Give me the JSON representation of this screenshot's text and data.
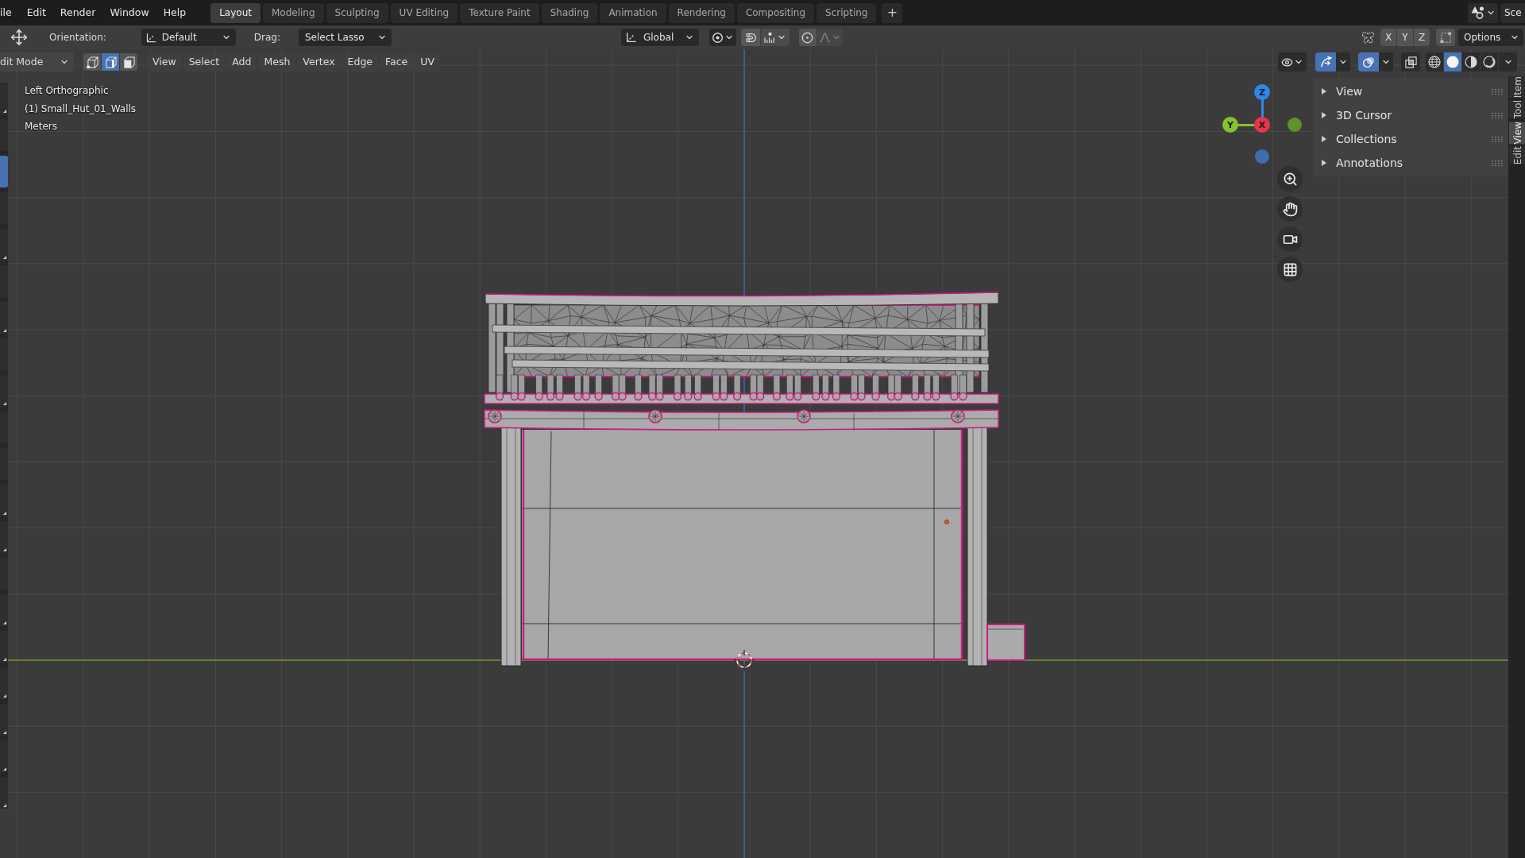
{
  "top_bar": {
    "menus": [
      "ile",
      "Edit",
      "Render",
      "Window",
      "Help"
    ],
    "workspaces": [
      {
        "label": "Layout",
        "selected": true
      },
      {
        "label": "Modeling",
        "selected": false
      },
      {
        "label": "Sculpting",
        "selected": false
      },
      {
        "label": "UV Editing",
        "selected": false
      },
      {
        "label": "Texture Paint",
        "selected": false
      },
      {
        "label": "Shading",
        "selected": false
      },
      {
        "label": "Animation",
        "selected": false
      },
      {
        "label": "Rendering",
        "selected": false
      },
      {
        "label": "Compositing",
        "selected": false
      },
      {
        "label": "Scripting",
        "selected": false
      }
    ],
    "add_workspace": "+",
    "scene": "Sce"
  },
  "tool_settings": {
    "orientation": {
      "label": "Orientation:",
      "value": "Default"
    },
    "drag": {
      "label": "Drag:",
      "value": "Select Lasso"
    },
    "transform_orientation": "Global",
    "proportional_editing": {
      "on": false
    },
    "mirror": [
      {
        "label": "X",
        "on": false
      },
      {
        "label": "Y",
        "on": false
      },
      {
        "label": "Z",
        "on": false
      }
    ],
    "options": "Options"
  },
  "viewport_header": {
    "mode": "dit Mode",
    "select_modes": [
      {
        "kind": "vertex",
        "selected": false
      },
      {
        "kind": "edge",
        "selected": true
      },
      {
        "kind": "face",
        "selected": false
      }
    ],
    "menus": [
      "View",
      "Select",
      "Add",
      "Mesh",
      "Vertex",
      "Edge",
      "Face",
      "UV"
    ],
    "gizmos": {
      "on": true
    },
    "overlays": {
      "on": true
    },
    "xray": {
      "on": false
    },
    "shading": [
      {
        "kind": "wireframe",
        "selected": false
      },
      {
        "kind": "solid",
        "selected": true
      },
      {
        "kind": "material",
        "selected": false
      },
      {
        "kind": "rendered",
        "selected": false
      }
    ]
  },
  "toolbar": {
    "tools": [
      {
        "selected": false,
        "subtools": true
      },
      {
        "selected": false,
        "subtools": false
      },
      {
        "selected": true,
        "subtools": false
      },
      {
        "selected": false,
        "subtools": false
      },
      {
        "selected": false,
        "subtools": true
      },
      {
        "selected": false,
        "subtools": false
      },
      {
        "selected": false,
        "subtools": true
      },
      {
        "selected": false,
        "subtools": false
      },
      {
        "selected": false,
        "subtools": true
      },
      {
        "selected": false,
        "subtools": false
      },
      {
        "selected": false,
        "subtools": false
      },
      {
        "selected": false,
        "subtools": true
      },
      {
        "selected": false,
        "subtools": true
      },
      {
        "selected": false,
        "subtools": false
      },
      {
        "selected": false,
        "subtools": true
      },
      {
        "selected": false,
        "subtools": true
      },
      {
        "selected": false,
        "subtools": true
      },
      {
        "selected": false,
        "subtools": true
      },
      {
        "selected": false,
        "subtools": true
      },
      {
        "selected": false,
        "subtools": true
      }
    ]
  },
  "viewport": {
    "view_name": "Left Orthographic",
    "object_name": "(1) Small_Hut_01_Walls",
    "units": "Meters"
  },
  "gizmo": {
    "axes": [
      {
        "kind": "axis",
        "label": "Z",
        "color": "#2e87ea"
      },
      {
        "kind": "axis",
        "label": "X",
        "color": "#e8354c"
      },
      {
        "kind": "axis",
        "label": "Y",
        "color": "#86c32b"
      },
      {
        "kind": "dot",
        "color": "#5f9130"
      },
      {
        "kind": "dot",
        "color": "#3f6eb0"
      }
    ]
  },
  "sidebar": {
    "panels": [
      {
        "label": "View",
        "expanded": false
      },
      {
        "label": "3D Cursor",
        "expanded": false
      },
      {
        "label": "Collections",
        "expanded": false
      },
      {
        "label": "Annotations",
        "expanded": false
      }
    ],
    "tabs": [
      {
        "label": "Item",
        "selected": false
      },
      {
        "label": "Tool",
        "selected": false
      },
      {
        "label": "View",
        "selected": true
      },
      {
        "label": "Edit",
        "selected": false
      }
    ]
  }
}
